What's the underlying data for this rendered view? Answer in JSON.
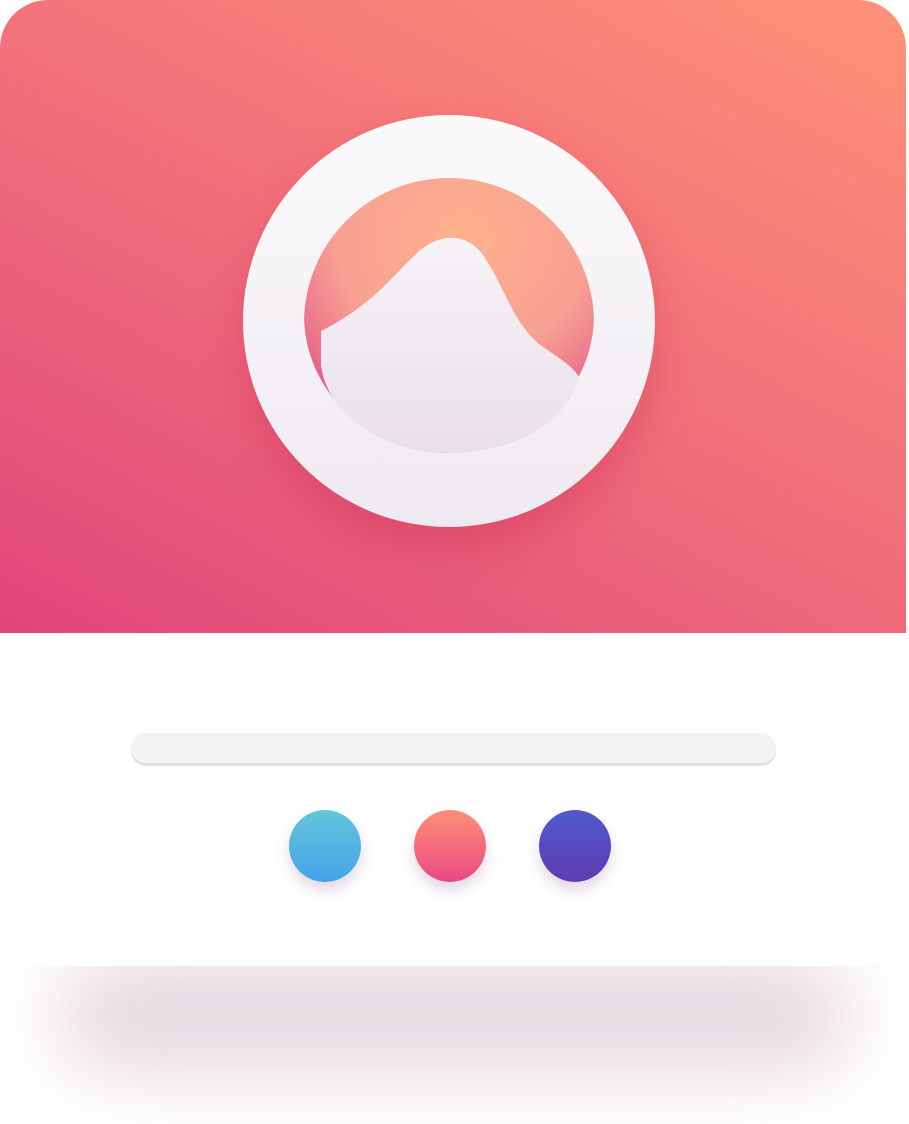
{
  "profile_card": {
    "header_gradient": [
      "#e0457b",
      "#ef6b7b",
      "#ff9277"
    ],
    "avatar": {
      "icon": "user-avatar-icon",
      "ring_color": "#f7f5f8",
      "head_color": "#ece3ec",
      "hair_colors": [
        "#ffb18c",
        "#e24d86"
      ]
    },
    "name_placeholder": {
      "icon": "text-line-placeholder",
      "color": "#f3f2f5"
    },
    "color_options": [
      {
        "name": "blue",
        "colors": [
          "#63c6dc",
          "#44a3e8"
        ]
      },
      {
        "name": "coral",
        "colors": [
          "#ff8f78",
          "#e84a80"
        ]
      },
      {
        "name": "indigo",
        "colors": [
          "#5159cc",
          "#5d3cb2"
        ]
      }
    ]
  }
}
